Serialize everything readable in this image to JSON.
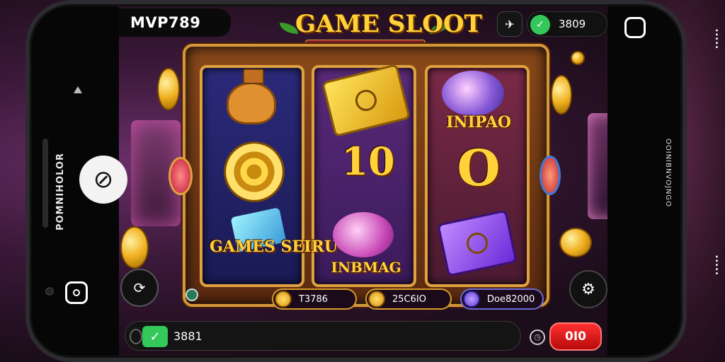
{
  "app": {
    "brand": "MVP789",
    "logo_title": "GAME SLOOT",
    "logo_subtitle": "FENGCHINUN TER GEHVAIN"
  },
  "topbar": {
    "icon_label": "✈",
    "balance_value": "3809"
  },
  "left_panel": {
    "side_label": "POMNIHOLOR",
    "circle_icon": "compass-icon"
  },
  "right_panel": {
    "vertical_label": "OOINIBNVOJNGO"
  },
  "reels": {
    "reel1": {
      "symbols": [
        "fox-character",
        "bullseye-arrow",
        "GAMES SEIRU"
      ],
      "text": "GAMES SEIRU"
    },
    "reel2": {
      "symbols": [
        "gold-coin-card",
        "10",
        "INBMAG"
      ],
      "text_mid": "10",
      "text_bottom": "INBMAG"
    },
    "reel3": {
      "symbols": [
        "candy-swirl",
        "INIPAO",
        "O",
        "purple-card"
      ],
      "text_top": "INIPAO",
      "text_mid": "O"
    }
  },
  "pills": [
    {
      "value": "T3786"
    },
    {
      "value": "25C6IO"
    },
    {
      "value": "Doe82000"
    }
  ],
  "bottom_bar": {
    "credit_value": "3881",
    "bet_button_label": "0I0"
  },
  "colors": {
    "accent_gold": "#ffd23a",
    "bet_red": "#ff3030",
    "balance_green": "#34c759"
  }
}
